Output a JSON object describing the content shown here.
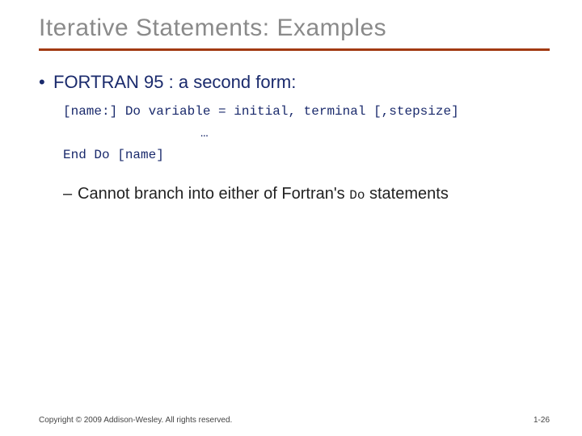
{
  "title": "Iterative Statements: Examples",
  "bullet1": "FORTRAN 95 : a second form:",
  "code": {
    "l1": "[name:] Do variable = initial, terminal [,stepsize]",
    "l2": "…",
    "l3": "End Do [name]"
  },
  "bullet2_pre": "Cannot branch into either of Fortran's ",
  "bullet2_mono": "Do",
  "bullet2_post": " statements",
  "footer_left": "Copyright © 2009 Addison-Wesley. All rights reserved.",
  "footer_right": "1-26"
}
